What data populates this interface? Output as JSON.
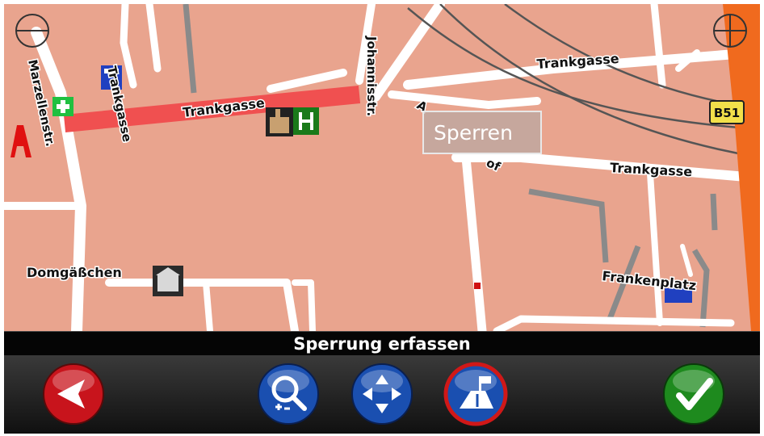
{
  "map": {
    "streets": [
      {
        "id": "marzellenstr",
        "label": "Marzellenstr."
      },
      {
        "id": "trankgasse-west",
        "label": "Trankgasse"
      },
      {
        "id": "trankgasse-route",
        "label": "Trankgasse"
      },
      {
        "id": "johannisstr",
        "label": "Johannisstr."
      },
      {
        "id": "trankgasse-ne",
        "label": "Trankgasse"
      },
      {
        "id": "trankgasse-east",
        "label": "Trankgasse"
      },
      {
        "id": "domgaesschen",
        "label": "Domgäßchen"
      },
      {
        "id": "frankenplatz",
        "label": "Frankenplatz"
      },
      {
        "id": "partial-a",
        "label": "A"
      },
      {
        "id": "partial-of",
        "label": "of"
      }
    ],
    "road_sign": "B51",
    "context_menu": {
      "label": "Sperren"
    },
    "zoom_out_icon": "zoom-out-icon",
    "zoom_in_icon": "zoom-in-icon"
  },
  "status": {
    "title": "Sperrung erfassen"
  },
  "toolbar": {
    "buttons": [
      {
        "id": "back",
        "icon": "back-arrow-icon",
        "color": "#c8141c"
      },
      {
        "id": "zoom",
        "icon": "magnifier-zoom-icon",
        "color": "#1a4fb0"
      },
      {
        "id": "pan",
        "icon": "pan-arrows-icon",
        "color": "#1a4fb0"
      },
      {
        "id": "road-block",
        "icon": "road-block-icon",
        "color": "#1a4fb0"
      },
      {
        "id": "confirm",
        "icon": "checkmark-icon",
        "color": "#1e8a1e"
      }
    ]
  },
  "colors": {
    "map_background": "#e9a48e",
    "street": "#ffffff",
    "route": "#f05050",
    "highway": "#f06a1e",
    "rail": "#555555"
  }
}
